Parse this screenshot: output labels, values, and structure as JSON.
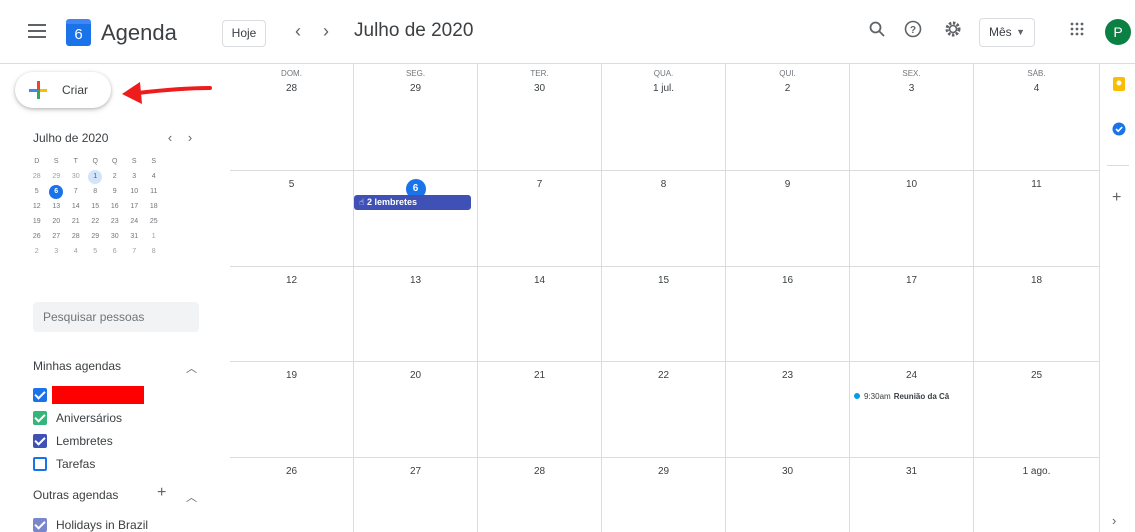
{
  "header": {
    "logo_number": "6",
    "app_title": "Agenda",
    "today_label": "Hoje",
    "prev_icon": "chevron-left-icon",
    "next_icon": "chevron-right-icon",
    "month_title": "Julho de 2020",
    "view_label": "Mês",
    "avatar_letter": "P"
  },
  "sidebar": {
    "create_label": "Criar",
    "mini_title": "Julho de 2020",
    "weekday_initials": [
      "D",
      "S",
      "T",
      "Q",
      "Q",
      "S",
      "S"
    ],
    "mini_weeks": [
      [
        "28",
        "29",
        "30",
        "1",
        "2",
        "3",
        "4"
      ],
      [
        "5",
        "6",
        "7",
        "8",
        "9",
        "10",
        "11"
      ],
      [
        "12",
        "13",
        "14",
        "15",
        "16",
        "17",
        "18"
      ],
      [
        "19",
        "20",
        "21",
        "22",
        "23",
        "24",
        "25"
      ],
      [
        "26",
        "27",
        "28",
        "29",
        "30",
        "31",
        "1"
      ],
      [
        "2",
        "3",
        "4",
        "5",
        "6",
        "7",
        "8"
      ]
    ],
    "search_placeholder": "Pesquisar pessoas",
    "my_calendars_title": "Minhas agendas",
    "my_calendars": [
      {
        "label": "",
        "color": "#1a73e8"
      },
      {
        "label": "Aniversários",
        "color": "#33b679"
      },
      {
        "label": "Lembretes",
        "color": "#3f51b5"
      },
      {
        "label": "Tarefas",
        "color": "#1a73e8"
      }
    ],
    "other_calendars_title": "Outras agendas",
    "other_calendars": [
      {
        "label": "Holidays in Brazil",
        "color": "#7986cb"
      }
    ]
  },
  "grid": {
    "dow_labels": [
      "DOM.",
      "SEG.",
      "TER.",
      "QUA.",
      "QUI.",
      "SEX.",
      "SÁB."
    ],
    "weeks": [
      [
        "28",
        "29",
        "30",
        "1 jul.",
        "2",
        "3",
        "4"
      ],
      [
        "5",
        "6",
        "7",
        "8",
        "9",
        "10",
        "11"
      ],
      [
        "12",
        "13",
        "14",
        "15",
        "16",
        "17",
        "18"
      ],
      [
        "19",
        "20",
        "21",
        "22",
        "23",
        "24",
        "25"
      ],
      [
        "26",
        "27",
        "28",
        "29",
        "30",
        "31",
        "1 ago."
      ]
    ],
    "reminder_chip": "2 lembretes",
    "event_time": "9:30am",
    "event_title": "Reunião da Câ",
    "today_color": "#1a73e8",
    "reminder_color": "#3f51b5"
  }
}
